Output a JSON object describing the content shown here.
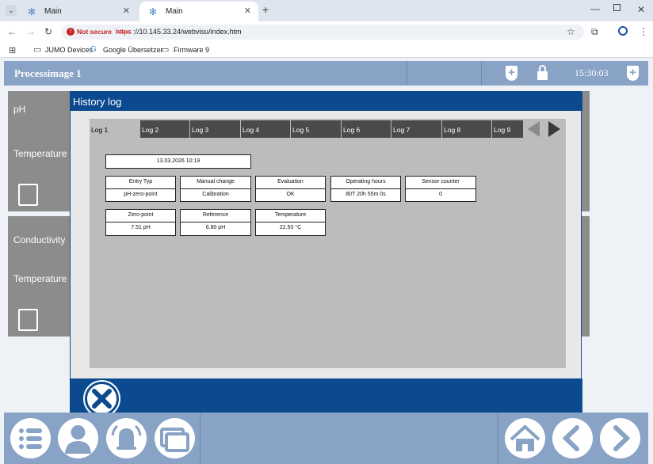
{
  "browser": {
    "tabs": [
      {
        "label": "Main"
      },
      {
        "label": "Main"
      }
    ],
    "security_label": "Not secure",
    "url_scheme": "https",
    "url_rest": "://10.145.33.24/webvisu/index.htm",
    "bookmarks": [
      {
        "label": "JUMO Devices"
      },
      {
        "label": "Google Übersetzer"
      },
      {
        "label": "Firmware 9"
      }
    ]
  },
  "header": {
    "title": "Processimage 1",
    "time": "15:30:03"
  },
  "sidebar": {
    "panel1": {
      "label1": "pH",
      "label2": "Temperature"
    },
    "panel2": {
      "label1": "Conductivity",
      "label2": "Temperature"
    }
  },
  "modal": {
    "title": "History log",
    "tabs": [
      "Log 1",
      "Log 2",
      "Log 3",
      "Log 4",
      "Log 5",
      "Log 6",
      "Log 7",
      "Log 8",
      "Log 9"
    ],
    "timestamp": "13.03.2026 10:19",
    "row1": [
      {
        "label": "Entry Typ",
        "value": "pH-zero-point"
      },
      {
        "label": "Manual change",
        "value": "Calibration"
      },
      {
        "label": "Evaluation",
        "value": "OK"
      },
      {
        "label": "Operating hours",
        "value": "80T 20h 55m 0s"
      },
      {
        "label": "Sensor counter",
        "value": "0"
      }
    ],
    "row2": [
      {
        "label": "Zero-point",
        "value": "7.51 pH"
      },
      {
        "label": "Reference",
        "value": "6.80 pH"
      },
      {
        "label": "Temperature",
        "value": "22.50 °C"
      }
    ]
  },
  "colors": {
    "accent": "#0b4a8f",
    "bar": "#88a3c5",
    "panel": "#8c8c8c"
  }
}
